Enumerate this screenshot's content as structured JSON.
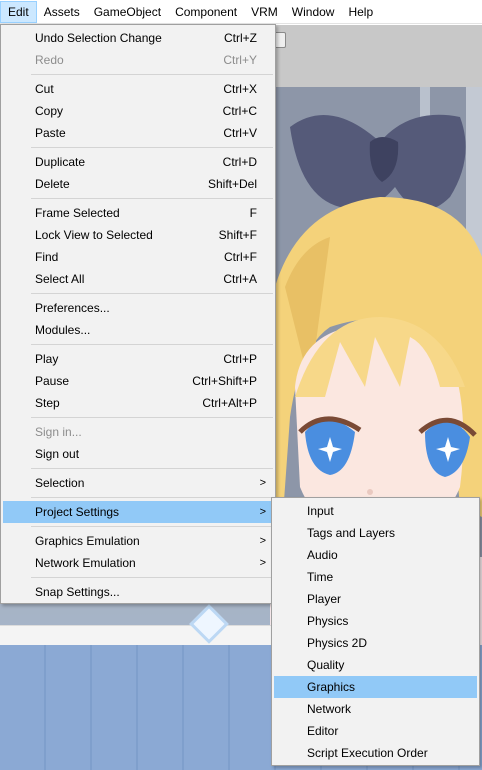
{
  "menubar": {
    "items": [
      "Edit",
      "Assets",
      "GameObject",
      "Component",
      "VRM",
      "Window",
      "Help"
    ]
  },
  "edit_menu": {
    "undo": {
      "label": "Undo Selection Change",
      "shortcut": "Ctrl+Z"
    },
    "redo": {
      "label": "Redo",
      "shortcut": "Ctrl+Y"
    },
    "cut": {
      "label": "Cut",
      "shortcut": "Ctrl+X"
    },
    "copy": {
      "label": "Copy",
      "shortcut": "Ctrl+C"
    },
    "paste": {
      "label": "Paste",
      "shortcut": "Ctrl+V"
    },
    "duplicate": {
      "label": "Duplicate",
      "shortcut": "Ctrl+D"
    },
    "delete": {
      "label": "Delete",
      "shortcut": "Shift+Del"
    },
    "frame_selected": {
      "label": "Frame Selected",
      "shortcut": "F"
    },
    "lock_view": {
      "label": "Lock View to Selected",
      "shortcut": "Shift+F"
    },
    "find": {
      "label": "Find",
      "shortcut": "Ctrl+F"
    },
    "select_all": {
      "label": "Select All",
      "shortcut": "Ctrl+A"
    },
    "preferences": {
      "label": "Preferences..."
    },
    "modules": {
      "label": "Modules..."
    },
    "play": {
      "label": "Play",
      "shortcut": "Ctrl+P"
    },
    "pause": {
      "label": "Pause",
      "shortcut": "Ctrl+Shift+P"
    },
    "step": {
      "label": "Step",
      "shortcut": "Ctrl+Alt+P"
    },
    "sign_in": {
      "label": "Sign in..."
    },
    "sign_out": {
      "label": "Sign out"
    },
    "selection": {
      "label": "Selection"
    },
    "project_settings": {
      "label": "Project Settings"
    },
    "graphics_emulation": {
      "label": "Graphics Emulation"
    },
    "network_emulation": {
      "label": "Network Emulation"
    },
    "snap_settings": {
      "label": "Snap Settings..."
    },
    "submenu_arrow": ">"
  },
  "project_settings_submenu": {
    "items": [
      "Input",
      "Tags and Layers",
      "Audio",
      "Time",
      "Player",
      "Physics",
      "Physics 2D",
      "Quality",
      "Graphics",
      "Network",
      "Editor",
      "Script Execution Order"
    ],
    "highlighted": "Graphics"
  },
  "colors": {
    "menu_bg": "#f2f2f2",
    "highlight": "#91c9f7",
    "disabled_text": "#8d8d8d",
    "menubar_active": "#cce8ff"
  }
}
